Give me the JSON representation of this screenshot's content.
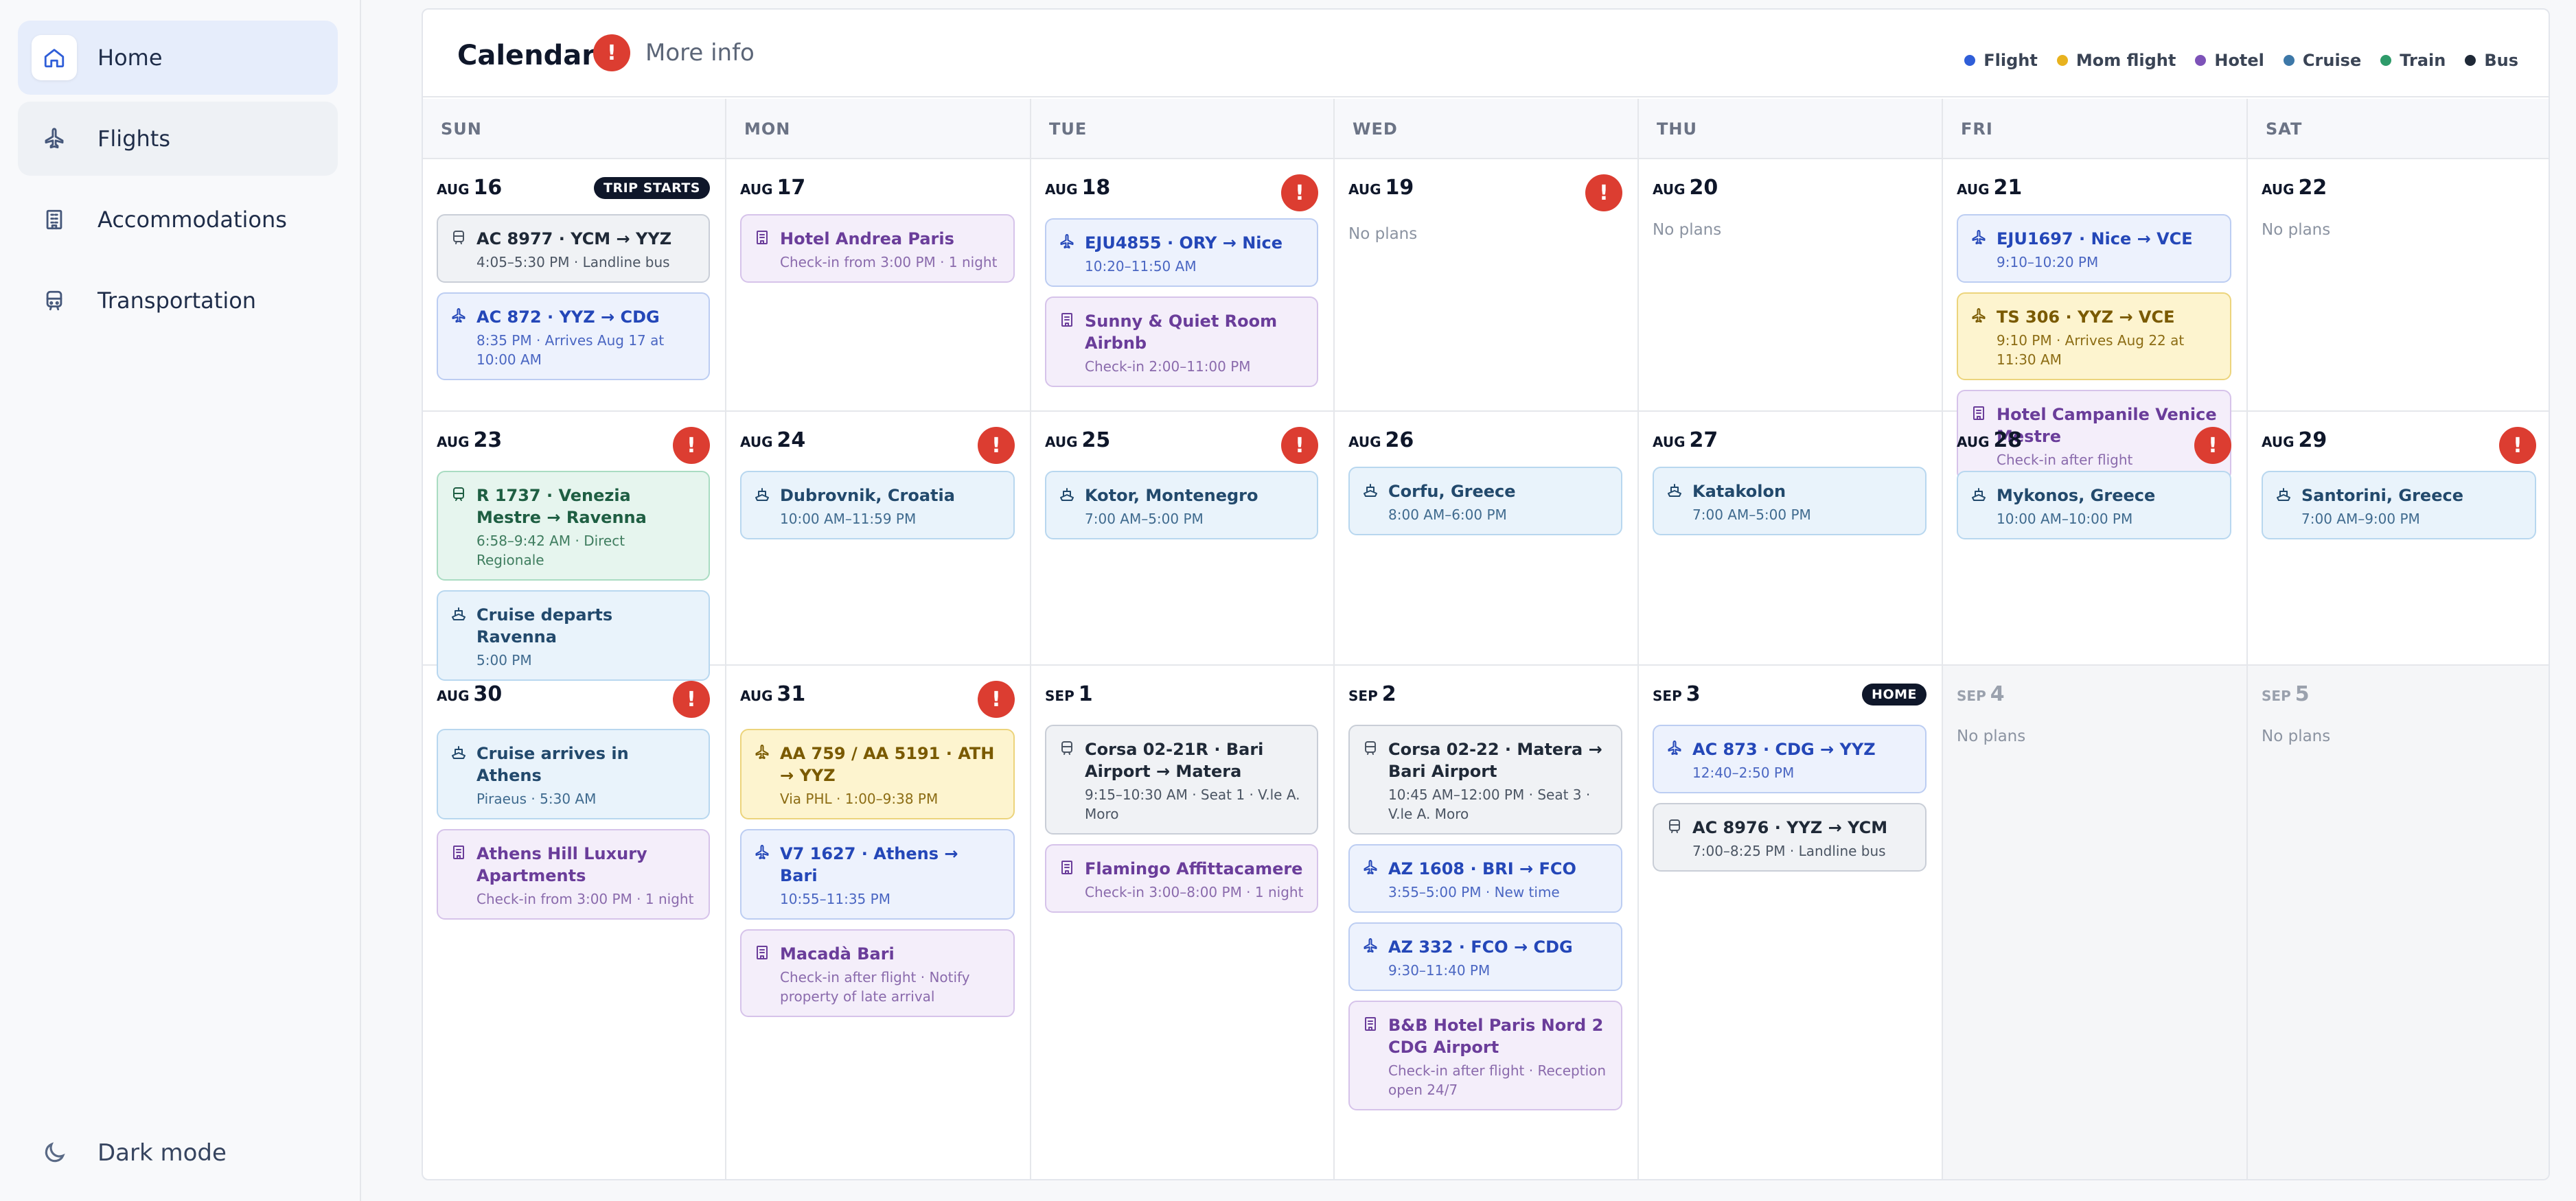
{
  "sidebar": {
    "items": [
      {
        "label": "Home",
        "icon": "home-icon"
      },
      {
        "label": "Flights",
        "icon": "plane-icon"
      },
      {
        "label": "Accommodations",
        "icon": "building-icon"
      },
      {
        "label": "Transportation",
        "icon": "bus-icon"
      }
    ],
    "dark_mode": "Dark mode"
  },
  "calendar": {
    "title": "Calendar",
    "warn_symbol": "!",
    "more_info": "More info",
    "legend": [
      {
        "label": "Flight",
        "color": "#2f5ed8"
      },
      {
        "label": "Mom flight",
        "color": "#e8b21e"
      },
      {
        "label": "Hotel",
        "color": "#7d52b8"
      },
      {
        "label": "Cruise",
        "color": "#3d78a8"
      },
      {
        "label": "Train",
        "color": "#2e9b6a"
      },
      {
        "label": "Bus",
        "color": "#1f2937"
      }
    ],
    "days_of_week": [
      "SUN",
      "MON",
      "TUE",
      "WED",
      "THU",
      "FRI",
      "SAT"
    ],
    "no_plans": "No plans",
    "days": [
      {
        "month": "AUG",
        "day": "16",
        "badge": "TRIP STARTS",
        "events": [
          {
            "type": "bus",
            "title": "AC 8977 · YCM → YYZ",
            "sub": "4:05–5:30 PM · Landline bus"
          },
          {
            "type": "flight",
            "title": "AC 872 · YYZ → CDG",
            "sub": "8:35 PM · Arrives Aug 17 at 10:00 AM"
          }
        ]
      },
      {
        "month": "AUG",
        "day": "17",
        "events": [
          {
            "type": "hotel",
            "title": "Hotel Andrea Paris",
            "sub": "Check-in from 3:00 PM · 1 night"
          }
        ]
      },
      {
        "month": "AUG",
        "day": "18",
        "warn": true,
        "events": [
          {
            "type": "flight",
            "title": "EJU4855 · ORY → Nice",
            "sub": "10:20–11:50 AM"
          },
          {
            "type": "hotel",
            "title": "Sunny & Quiet Room Airbnb",
            "sub": "Check-in 2:00–11:00 PM"
          }
        ]
      },
      {
        "month": "AUG",
        "day": "19",
        "warn": true,
        "events": []
      },
      {
        "month": "AUG",
        "day": "20",
        "events": []
      },
      {
        "month": "AUG",
        "day": "21",
        "events": [
          {
            "type": "flight",
            "title": "EJU1697 · Nice → VCE",
            "sub": "9:10–10:20 PM"
          },
          {
            "type": "mom",
            "title": "TS 306 · YYZ → VCE",
            "sub": "9:10 PM · Arrives Aug 22 at 11:30 AM"
          },
          {
            "type": "hotel",
            "title": "Hotel Campanile Venice Mestre",
            "sub": "Check-in after flight"
          }
        ]
      },
      {
        "month": "AUG",
        "day": "22",
        "events": []
      },
      {
        "month": "AUG",
        "day": "23",
        "warn": true,
        "events": [
          {
            "type": "train",
            "title": "R 1737 · Venezia Mestre → Ravenna",
            "sub": "6:58–9:42 AM · Direct Regionale"
          },
          {
            "type": "cruise",
            "title": "Cruise departs Ravenna",
            "sub": "5:00 PM"
          }
        ]
      },
      {
        "month": "AUG",
        "day": "24",
        "warn": true,
        "events": [
          {
            "type": "cruise",
            "title": "Dubrovnik, Croatia",
            "sub": "10:00 AM–11:59 PM"
          }
        ]
      },
      {
        "month": "AUG",
        "day": "25",
        "warn": true,
        "events": [
          {
            "type": "cruise",
            "title": "Kotor, Montenegro",
            "sub": "7:00 AM–5:00 PM"
          }
        ]
      },
      {
        "month": "AUG",
        "day": "26",
        "events": [
          {
            "type": "cruise",
            "title": "Corfu, Greece",
            "sub": "8:00 AM–6:00 PM"
          }
        ]
      },
      {
        "month": "AUG",
        "day": "27",
        "events": [
          {
            "type": "cruise",
            "title": "Katakolon",
            "sub": "7:00 AM–5:00 PM"
          }
        ]
      },
      {
        "month": "AUG",
        "day": "28",
        "warn": true,
        "events": [
          {
            "type": "cruise",
            "title": "Mykonos, Greece",
            "sub": "10:00 AM–10:00 PM"
          }
        ]
      },
      {
        "month": "AUG",
        "day": "29",
        "warn": true,
        "events": [
          {
            "type": "cruise",
            "title": "Santorini, Greece",
            "sub": "7:00 AM–9:00 PM"
          }
        ]
      },
      {
        "month": "AUG",
        "day": "30",
        "warn": true,
        "events": [
          {
            "type": "cruise",
            "title": "Cruise arrives in Athens",
            "sub": "Piraeus · 5:30 AM"
          },
          {
            "type": "hotel",
            "title": "Athens Hill Luxury Apartments",
            "sub": "Check-in from 3:00 PM · 1 night"
          }
        ]
      },
      {
        "month": "AUG",
        "day": "31",
        "warn": true,
        "events": [
          {
            "type": "mom",
            "title": "AA 759 / AA 5191 · ATH → YYZ",
            "sub": "Via PHL · 1:00–9:38 PM"
          },
          {
            "type": "flight",
            "title": "V7 1627 · Athens → Bari",
            "sub": "10:55–11:35 PM"
          },
          {
            "type": "hotel",
            "title": "Macadà Bari",
            "sub": "Check-in after flight · Notify property of late arrival"
          }
        ]
      },
      {
        "month": "SEP",
        "day": "1",
        "events": [
          {
            "type": "bus",
            "title": "Corsa 02-21R · Bari Airport → Matera",
            "sub": "9:15–10:30 AM · Seat 1 · V.le A. Moro"
          },
          {
            "type": "hotel",
            "title": "Flamingo Affittacamere",
            "sub": "Check-in 3:00–8:00 PM · 1 night"
          }
        ]
      },
      {
        "month": "SEP",
        "day": "2",
        "events": [
          {
            "type": "bus",
            "title": "Corsa 02-22 · Matera → Bari Airport",
            "sub": "10:45 AM–12:00 PM · Seat 3 · V.le A. Moro"
          },
          {
            "type": "flight",
            "title": "AZ 1608 · BRI → FCO",
            "sub": "3:55–5:00 PM · New time"
          },
          {
            "type": "flight",
            "title": "AZ 332 · FCO → CDG",
            "sub": "9:30–11:40 PM"
          },
          {
            "type": "hotel",
            "title": "B&B Hotel Paris Nord 2 CDG Airport",
            "sub": "Check-in after flight · Reception open 24/7"
          }
        ]
      },
      {
        "month": "SEP",
        "day": "3",
        "badge": "HOME",
        "events": [
          {
            "type": "flight",
            "title": "AC 873 · CDG → YYZ",
            "sub": "12:40–2:50 PM"
          },
          {
            "type": "bus",
            "title": "AC 8976 · YYZ → YCM",
            "sub": "7:00–8:25 PM · Landline bus"
          }
        ]
      },
      {
        "month": "SEP",
        "day": "4",
        "dim": true,
        "events": []
      },
      {
        "month": "SEP",
        "day": "5",
        "dim": true,
        "events": []
      }
    ]
  }
}
